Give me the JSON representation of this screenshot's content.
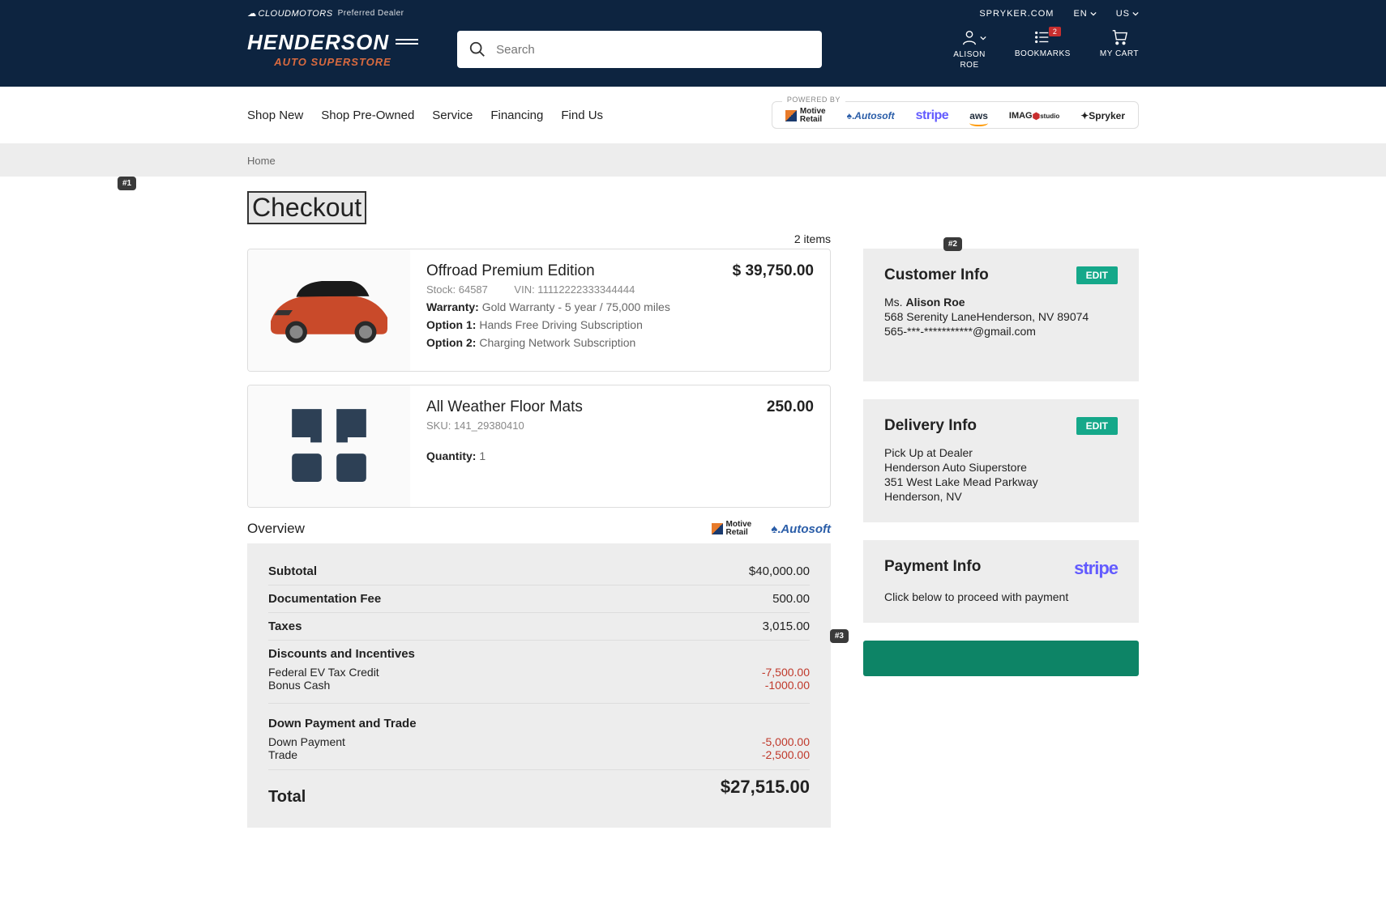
{
  "topbar": {
    "cloudmotors": "CLOUDMOTORS",
    "preferred": "Preferred Dealer",
    "spryker_link": "SPRYKER.COM",
    "lang": "EN",
    "region": "US"
  },
  "logo": {
    "main": "HENDERSON",
    "sub": "AUTO SUPERSTORE"
  },
  "search": {
    "placeholder": "Search"
  },
  "header_actions": {
    "account_first": "ALISON",
    "account_last": "ROE",
    "bookmarks": "BOOKMARKS",
    "bookmarks_badge": "2",
    "cart": "MY CART"
  },
  "nav": {
    "shop_new": "Shop New",
    "shop_preowned": "Shop Pre-Owned",
    "service": "Service",
    "financing": "Financing",
    "find_us": "Find Us",
    "powered_by": "POWERED BY"
  },
  "partner_logos": {
    "motive1": "Motive",
    "motive2": "Retail",
    "autosoft": "Autosoft",
    "stripe": "stripe",
    "aws": "aws",
    "imag": "IMAG",
    "imag2": "studio",
    "spryker": "Spryker"
  },
  "breadcrumb": {
    "home": "Home"
  },
  "tags": {
    "t1": "#1",
    "t2": "#2",
    "t3": "#3"
  },
  "page": {
    "title": "Checkout",
    "item_count": "2 items"
  },
  "items": [
    {
      "name": "Offroad Premium Edition",
      "price": "$ 39,750.00",
      "stock": "Stock: 64587",
      "vin": "VIN: 11112222333344444",
      "warranty_lbl": "Warranty:",
      "warranty_val": "Gold Warranty  - 5 year / 75,000 miles",
      "opt1_lbl": "Option 1:",
      "opt1_val": "Hands Free Driving Subscription",
      "opt2_lbl": "Option 2:",
      "opt2_val": "Charging Network Subscription"
    },
    {
      "name": "All Weather Floor Mats",
      "price": "250.00",
      "sku": "SKU: 141_29380410",
      "qty_lbl": "Quantity:",
      "qty_val": "1"
    }
  ],
  "overview": {
    "title": "Overview",
    "subtotal_lbl": "Subtotal",
    "subtotal_val": "$40,000.00",
    "doc_lbl": "Documentation Fee",
    "doc_val": "500.00",
    "tax_lbl": "Taxes",
    "tax_val": "3,015.00",
    "disc_lbl": "Discounts and Incentives",
    "fed_lbl": "Federal EV Tax Credit",
    "fed_val": "-7,500.00",
    "bonus_lbl": "Bonus Cash",
    "bonus_val": "-1000.00",
    "down_hdr": "Down Payment and Trade",
    "down_lbl": "Down Payment",
    "down_val": "-5,000.00",
    "trade_lbl": "Trade",
    "trade_val": "-2,500.00",
    "total_lbl": "Total",
    "total_val": "$27,515.00"
  },
  "customer": {
    "title": "Customer Info",
    "edit": "EDIT",
    "salutation": "Ms. ",
    "name": "Alison Roe",
    "addr": "568 Serenity LaneHenderson, NV 89074",
    "contact": "565-***-***********@gmail.com"
  },
  "delivery": {
    "title": "Delivery Info",
    "edit": "EDIT",
    "line1": "Pick Up at Dealer",
    "line2": "Henderson Auto Siuperstore",
    "line3": "351 West Lake Mead Parkway",
    "line4": "Henderson, NV"
  },
  "payment": {
    "title": "Payment Info",
    "instruction": "Click below to proceed with payment"
  }
}
